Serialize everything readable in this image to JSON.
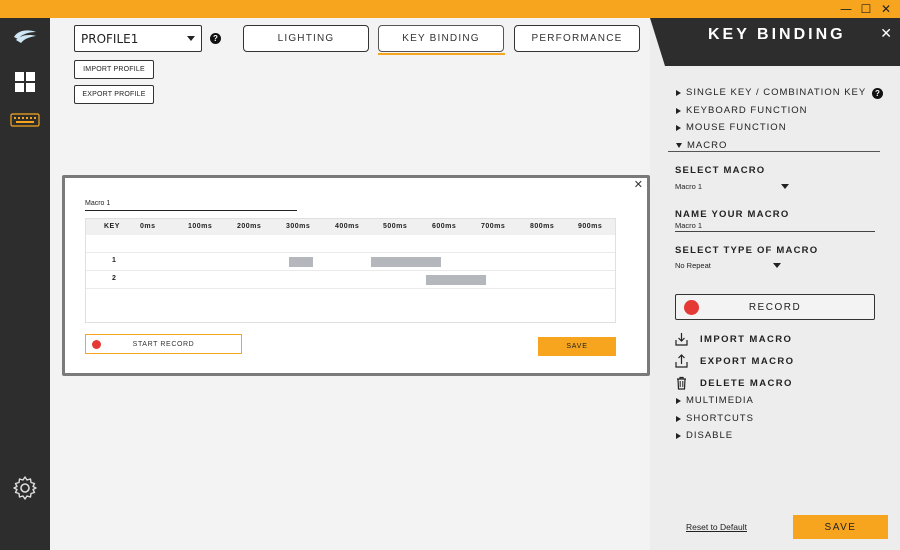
{
  "window": {
    "minimize": "—",
    "maximize": "☐",
    "close": "✕"
  },
  "profile": {
    "selected": "PROFILE1",
    "import_label": "IMPORT PROFILE",
    "export_label": "EXPORT PROFILE"
  },
  "tabs": [
    {
      "label": "LIGHTING"
    },
    {
      "label": "KEY BINDING"
    },
    {
      "label": "PERFORMANCE"
    }
  ],
  "dialog": {
    "close": "✕",
    "macro_name": "Macro 1",
    "timeline_headers": [
      "KEY",
      "0ms",
      "100ms",
      "200ms",
      "300ms",
      "400ms",
      "500ms",
      "600ms",
      "700ms",
      "800ms",
      "900ms"
    ],
    "rows": [
      {
        "label": "1",
        "events": [
          {
            "start": 294,
            "end": 344
          },
          {
            "start": 462,
            "end": 607
          }
        ]
      },
      {
        "label": "2",
        "events": [
          {
            "start": 575,
            "end": 698
          }
        ]
      }
    ],
    "start_record_label": "START RECORD",
    "save_label": "SAVE"
  },
  "panel": {
    "title": "KEY BINDING",
    "close": "✕",
    "categories_top": [
      {
        "label": "SINGLE KEY / COMBINATION KEY"
      },
      {
        "label": "KEYBOARD FUNCTION"
      },
      {
        "label": "MOUSE FUNCTION"
      },
      {
        "label": "MACRO"
      }
    ],
    "select_macro_label": "SELECT MACRO",
    "select_macro_value": "Macro 1",
    "name_macro_label": "NAME YOUR MACRO",
    "name_macro_value": "Macro 1",
    "type_macro_label": "SELECT TYPE OF MACRO",
    "type_macro_value": "No Repeat",
    "record_label": "RECORD",
    "import_macro": "IMPORT MACRO",
    "export_macro": "EXPORT MACRO",
    "delete_macro": "DELETE MACRO",
    "categories_bottom": [
      {
        "label": "MULTIMEDIA"
      },
      {
        "label": "SHORTCUTS"
      },
      {
        "label": "DISABLE"
      }
    ],
    "reset_label": "Reset to Default",
    "save_label": "SAVE"
  },
  "colors": {
    "accent": "#f7a51f",
    "dark": "#2d2d2d",
    "record_red": "#e53935",
    "bar_gray": "#b4b8bd"
  }
}
